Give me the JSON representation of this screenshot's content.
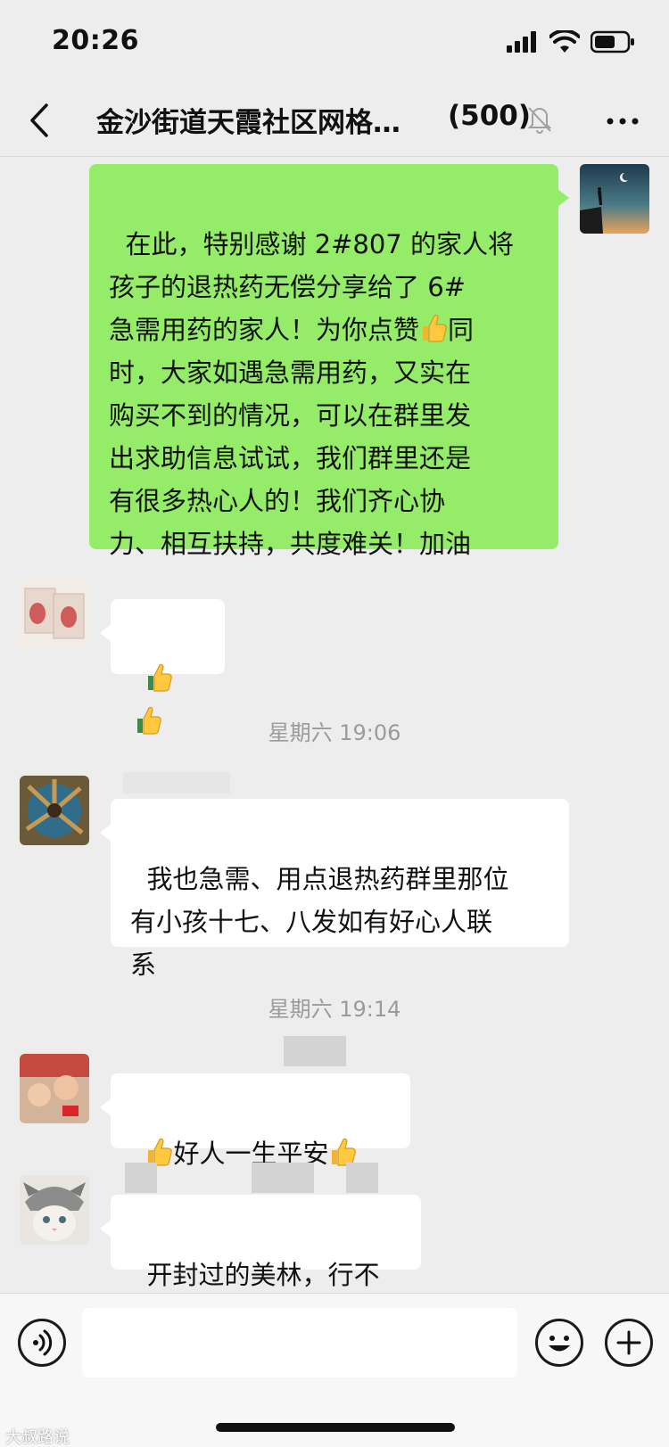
{
  "status_bar": {
    "time": "20:26"
  },
  "header": {
    "title": "金沙街道天霞社区网格…",
    "member_count": "(500)"
  },
  "messages": {
    "m1": {
      "text": "在此，特别感谢 2#807 的家人将\n孩子的退热药无偿分享给了 6#\n急需用药的家人！为你点赞",
      "text2": "同\n时，大家如遇急需用药，又实在\n购买不到的情况，可以在群里发\n出求助信息试试，我们群里还是\n有很多热心人的！我们齐心协\n力、相互扶持，共度难关！加油"
    },
    "m3": {
      "text": "我也急需、用点退热药群里那位\n有小孩十七、八发如有好心人联\n系"
    },
    "m4": {
      "text": "好人一生平安"
    },
    "m5": {
      "text": "开封过的美林，行不"
    }
  },
  "timestamps": {
    "t1": "星期六 19:06",
    "t2": "星期六 19:14"
  },
  "watermark": "大叔路说",
  "colors": {
    "self_bubble": "#95ec69",
    "other_bubble": "#ffffff",
    "background": "#ededed"
  },
  "icons": [
    "back-chevron",
    "mute-bell",
    "more-dots",
    "voice",
    "emoji",
    "plus",
    "thumbs-up"
  ]
}
